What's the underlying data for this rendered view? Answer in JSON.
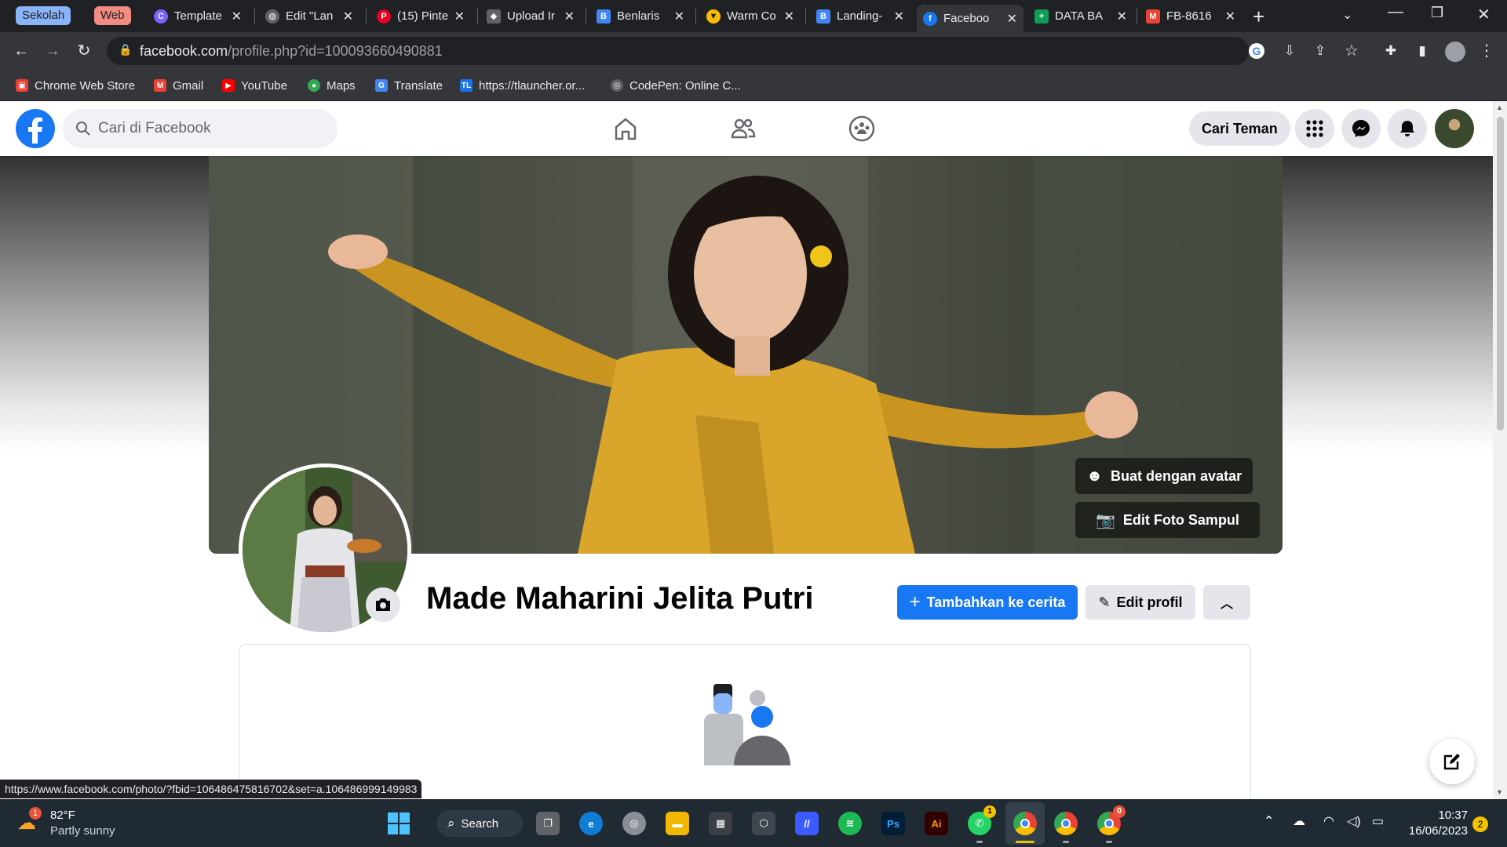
{
  "browser": {
    "tab_groups": [
      {
        "label": "Sekolah",
        "color": "#8ab4f8"
      },
      {
        "label": "Web",
        "color": "#f28b82"
      }
    ],
    "tabs": [
      {
        "title": "Template",
        "icon": "canva-icon",
        "color": "#7b61ff"
      },
      {
        "title": "Edit \"Lan",
        "icon": "globe-icon",
        "color": "#5f6368"
      },
      {
        "title": "(15) Pinte",
        "icon": "pinterest-icon",
        "color": "#e60023"
      },
      {
        "title": "Upload Ir",
        "icon": "layers-icon",
        "color": "#5f6368"
      },
      {
        "title": "Benlaris",
        "icon": "blogger-icon",
        "color": "#4285f4"
      },
      {
        "title": "Warm Co",
        "icon": "shield-icon",
        "color": "#fbbc04"
      },
      {
        "title": "Landing-",
        "icon": "b-icon",
        "color": "#4285f4"
      },
      {
        "title": "Faceboo",
        "icon": "facebook-icon",
        "color": "#1877f2"
      },
      {
        "title": "DATA BA",
        "icon": "sheets-icon",
        "color": "#0f9d58"
      },
      {
        "title": "FB-8616",
        "icon": "gmail-icon",
        "color": "#ea4335"
      }
    ],
    "url_domain": "facebook.com",
    "url_path": "/profile.php?id=100093660490881",
    "bookmarks": [
      {
        "label": "Chrome Web Store",
        "icon": "webstore-icon",
        "color": "#ea4335"
      },
      {
        "label": "Gmail",
        "icon": "gmail-icon",
        "color": "#ea4335"
      },
      {
        "label": "YouTube",
        "icon": "youtube-icon",
        "color": "#ff0000"
      },
      {
        "label": "Maps",
        "icon": "maps-icon",
        "color": "#34a853"
      },
      {
        "label": "Translate",
        "icon": "translate-icon",
        "color": "#4285f4"
      },
      {
        "label": "https://tlauncher.or...",
        "icon": "tlauncher-icon",
        "color": "#1a73e8"
      },
      {
        "label": "CodePen: Online C...",
        "icon": "codepen-icon",
        "color": "#5f6368"
      }
    ]
  },
  "facebook": {
    "search_placeholder": "Cari di Facebook",
    "find_friends_label": "Cari Teman",
    "brand_color": "#1877f2",
    "cover_buttons": {
      "avatar": "Buat dengan avatar",
      "edit_cover": "Edit Foto Sampul"
    },
    "profile_name": "Made Maharini Jelita Putri",
    "add_story_label": "Tambahkan ke cerita",
    "edit_profile_label": "Edit profil"
  },
  "status_bar_url": "https://www.facebook.com/photo/?fbid=106486475816702&set=a.106486999149983",
  "taskbar": {
    "weather_temp": "82°F",
    "weather_desc": "Partly sunny",
    "weather_badge": "1",
    "search_label": "Search",
    "time": "10:37",
    "date": "16/06/2023",
    "notification_count": "2",
    "whatsapp_badge": "1",
    "chrome_badge": "0"
  }
}
